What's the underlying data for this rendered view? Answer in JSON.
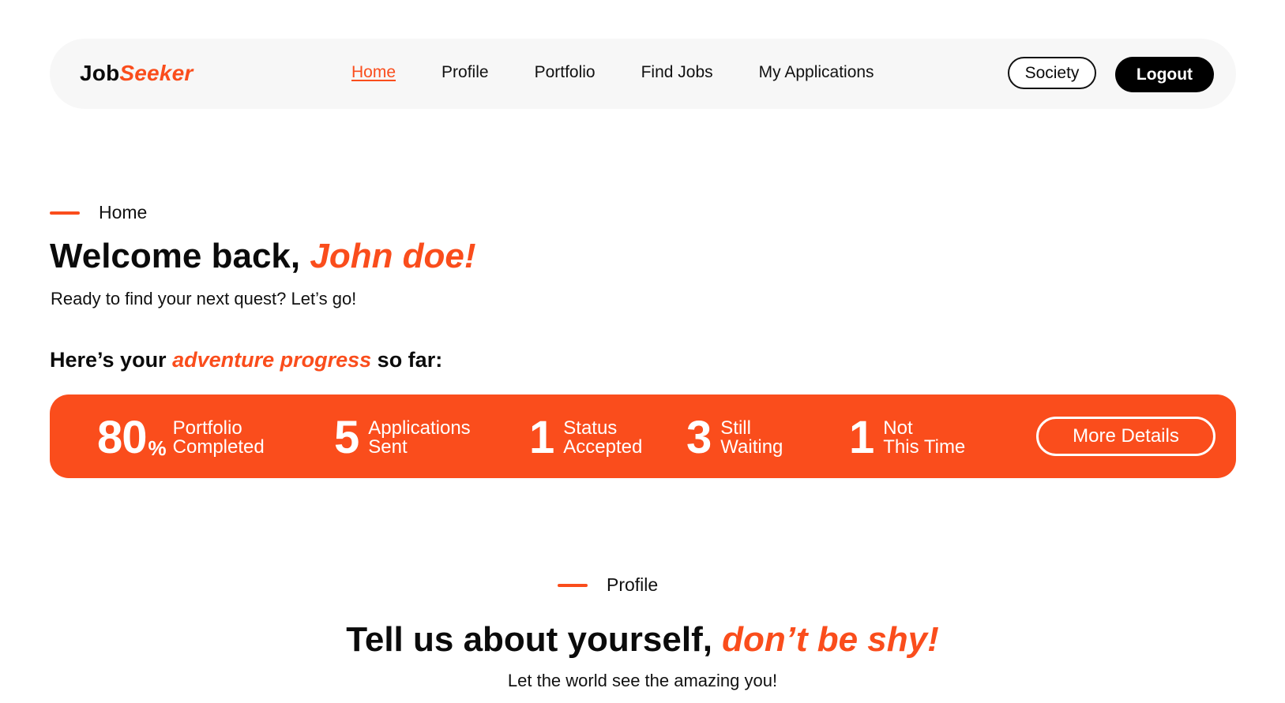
{
  "nav": {
    "logo_main": "Job",
    "logo_accent": "Seeker",
    "links": [
      "Home",
      "Profile",
      "Portfolio",
      "Find Jobs",
      "My Applications"
    ],
    "active_link": "Home",
    "society_label": "Society",
    "logout_label": "Logout"
  },
  "home": {
    "eyebrow": "Home",
    "welcome_prefix": "Welcome back, ",
    "welcome_name": "John doe!",
    "subtitle": "Ready to find your next quest? Let’s go!",
    "progress_prefix": "Here’s your ",
    "progress_accent": "adventure progress",
    "progress_suffix": " so far:"
  },
  "stats": {
    "portfolio": {
      "value": "80",
      "suffix": "%",
      "line1": "Portfolio",
      "line2": "Completed"
    },
    "applications": {
      "value": "5",
      "line1": "Applications",
      "line2": "Sent"
    },
    "accepted": {
      "value": "1",
      "line1": "Status",
      "line2": "Accepted"
    },
    "waiting": {
      "value": "3",
      "line1": "Still",
      "line2": "Waiting"
    },
    "rejected": {
      "value": "1",
      "line1": "Not",
      "line2": "This Time"
    },
    "more_details_label": "More Details"
  },
  "profile": {
    "eyebrow": "Profile",
    "title_prefix": "Tell us about yourself, ",
    "title_accent": "don’t be shy!",
    "subtitle": "Let the world see the amazing you!"
  },
  "colors": {
    "accent": "#fa4d1c",
    "nav_bg": "#f7f7f7",
    "text": "#0b0b0b"
  }
}
